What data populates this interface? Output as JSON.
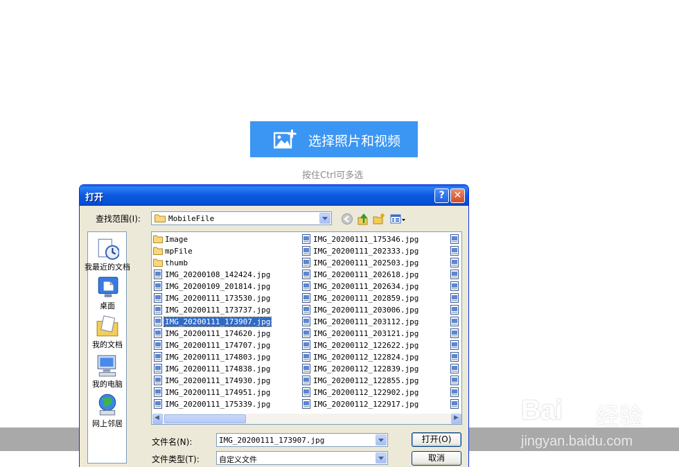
{
  "page": {
    "upload_button": "选择照片和视频",
    "hint": "按住Ctrl可多选",
    "watermark_logo": "Bai",
    "watermark_cn": "经验",
    "watermark_url": "jingyan.baidu.com"
  },
  "dialog": {
    "title": "打开",
    "help_glyph": "?",
    "close_glyph": "✕",
    "look_in_label": "查找范围(I):",
    "look_in_value": "MobileFile",
    "places": [
      {
        "label": "我最近的文档",
        "icon": "recent-documents-icon"
      },
      {
        "label": "桌面",
        "icon": "desktop-icon"
      },
      {
        "label": "我的文档",
        "icon": "my-documents-icon"
      },
      {
        "label": "我的电脑",
        "icon": "my-computer-icon"
      },
      {
        "label": "网上邻居",
        "icon": "network-places-icon"
      }
    ],
    "columns": [
      [
        {
          "name": "Image",
          "type": "folder"
        },
        {
          "name": "mpFile",
          "type": "folder"
        },
        {
          "name": "thumb",
          "type": "folder"
        },
        {
          "name": "IMG_20200108_142424.jpg",
          "type": "jpg"
        },
        {
          "name": "IMG_20200109_201814.jpg",
          "type": "jpg"
        },
        {
          "name": "IMG_20200111_173530.jpg",
          "type": "jpg"
        },
        {
          "name": "IMG_20200111_173737.jpg",
          "type": "jpg"
        },
        {
          "name": "IMG_20200111_173907.jpg",
          "type": "jpg",
          "selected": true
        },
        {
          "name": "IMG_20200111_174620.jpg",
          "type": "jpg"
        },
        {
          "name": "IMG_20200111_174707.jpg",
          "type": "jpg"
        },
        {
          "name": "IMG_20200111_174803.jpg",
          "type": "jpg"
        },
        {
          "name": "IMG_20200111_174838.jpg",
          "type": "jpg"
        },
        {
          "name": "IMG_20200111_174930.jpg",
          "type": "jpg"
        },
        {
          "name": "IMG_20200111_174951.jpg",
          "type": "jpg"
        },
        {
          "name": "IMG_20200111_175339.jpg",
          "type": "jpg"
        }
      ],
      [
        {
          "name": "IMG_20200111_175346.jpg",
          "type": "jpg"
        },
        {
          "name": "IMG_20200111_202333.jpg",
          "type": "jpg"
        },
        {
          "name": "IMG_20200111_202503.jpg",
          "type": "jpg"
        },
        {
          "name": "IMG_20200111_202618.jpg",
          "type": "jpg"
        },
        {
          "name": "IMG_20200111_202634.jpg",
          "type": "jpg"
        },
        {
          "name": "IMG_20200111_202859.jpg",
          "type": "jpg"
        },
        {
          "name": "IMG_20200111_203006.jpg",
          "type": "jpg"
        },
        {
          "name": "IMG_20200111_203112.jpg",
          "type": "jpg"
        },
        {
          "name": "IMG_20200111_203121.jpg",
          "type": "jpg"
        },
        {
          "name": "IMG_20200112_122622.jpg",
          "type": "jpg"
        },
        {
          "name": "IMG_20200112_122824.jpg",
          "type": "jpg"
        },
        {
          "name": "IMG_20200112_122839.jpg",
          "type": "jpg"
        },
        {
          "name": "IMG_20200112_122855.jpg",
          "type": "jpg"
        },
        {
          "name": "IMG_20200112_122902.jpg",
          "type": "jpg"
        },
        {
          "name": "IMG_20200112_122917.jpg",
          "type": "jpg"
        }
      ]
    ],
    "scroll_left_glyph": "◀",
    "scroll_right_glyph": "▶",
    "filename_label": "文件名(N):",
    "filename_value": "IMG_20200111_173907.jpg",
    "filetype_label": "文件类型(T):",
    "filetype_value": "自定义文件",
    "open_button": "打开(O)",
    "cancel_button": "取消",
    "colors": {
      "title_blue": "#0450d6",
      "selection": "#316ac5",
      "dialog_face": "#ece9d8",
      "page_accent": "#3b96f3"
    }
  }
}
